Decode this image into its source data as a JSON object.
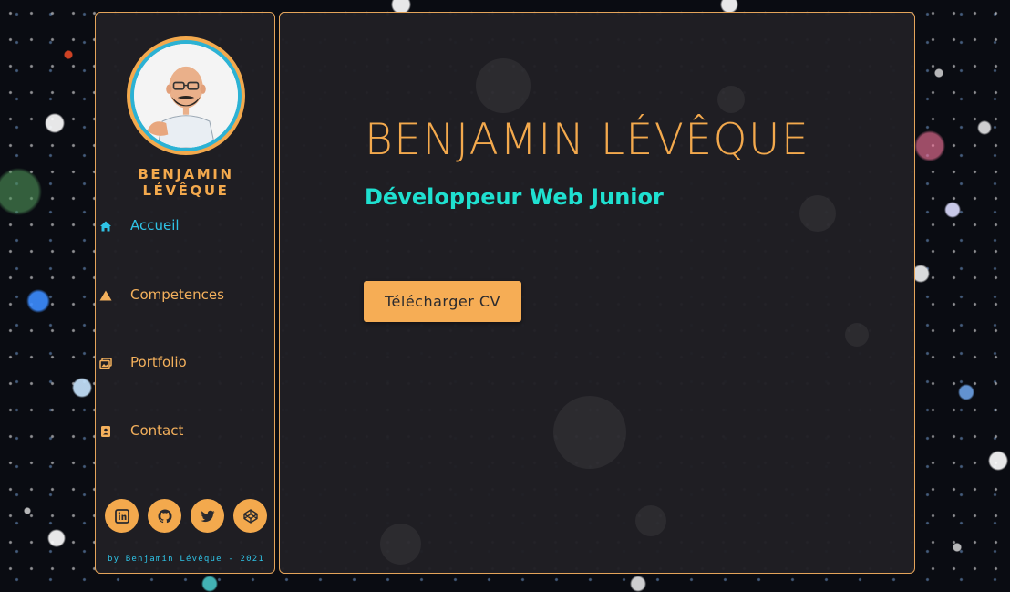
{
  "sidebar": {
    "name": "BENJAMIN LÉVÊQUE",
    "nav": [
      {
        "label": "Accueil",
        "icon": "home-icon",
        "active": true
      },
      {
        "label": "Competences",
        "icon": "warning-triangle-icon",
        "active": false
      },
      {
        "label": "Portfolio",
        "icon": "images-icon",
        "active": false
      },
      {
        "label": "Contact",
        "icon": "contact-card-icon",
        "active": false
      }
    ],
    "socials": [
      "linkedin-icon",
      "github-icon",
      "twitter-icon",
      "codepen-icon"
    ],
    "copyright": "by Benjamin Lévêque - 2021"
  },
  "main": {
    "title": "BENJAMIN LÉVÊQUE",
    "subtitle": "Développeur Web Junior",
    "cv_button": "Télécharger CV"
  },
  "colors": {
    "accent_orange": "#f3a94d",
    "accent_cyan": "#2fc3e6",
    "accent_teal": "#1fe0d0",
    "panel_bg": "#201f24"
  }
}
